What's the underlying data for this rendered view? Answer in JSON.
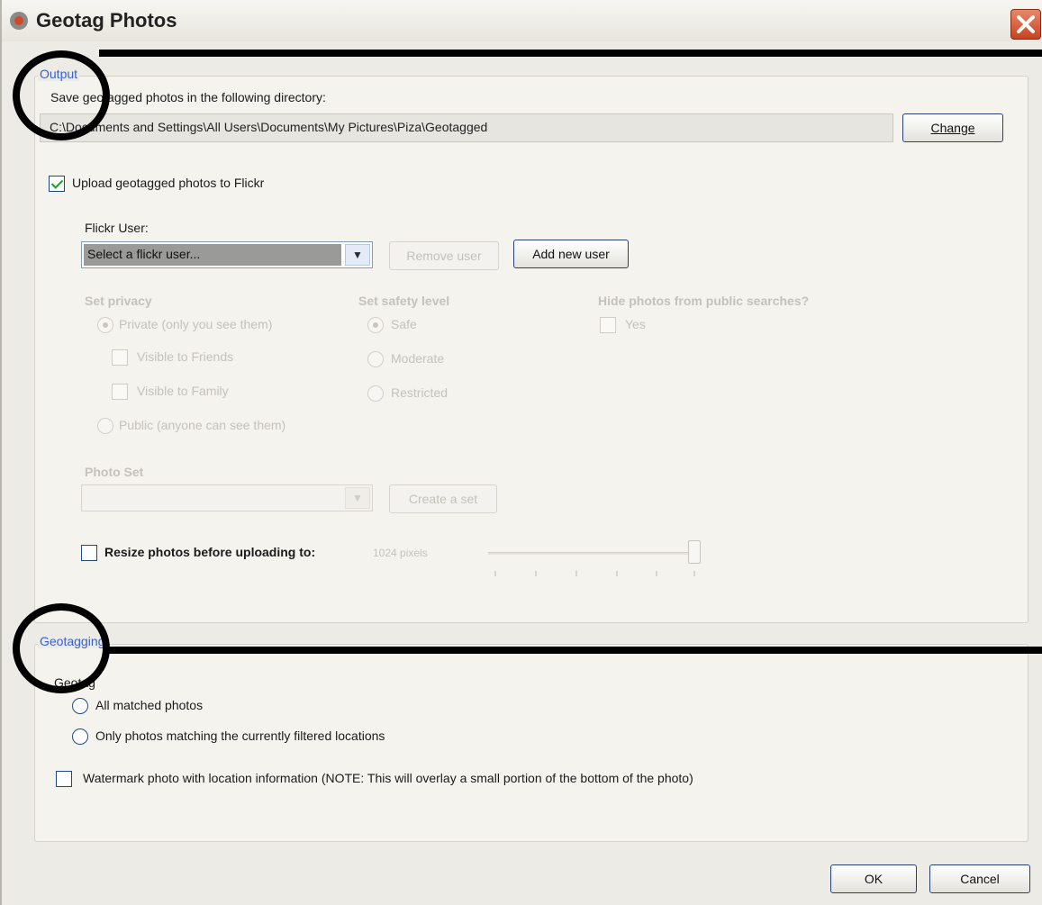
{
  "window": {
    "title": "Geotag Photos"
  },
  "output": {
    "legend": "Output",
    "save_label": "Save geotagged photos in the following directory:",
    "path_value": "C:\\Documents and Settings\\All Users\\Documents\\My Pictures\\Piza\\Geotagged",
    "change_button": "Change",
    "upload_label": "Upload geotagged photos to Flickr",
    "flickr_user_label": "Flickr User:",
    "flickr_user_select": "Select a flickr user...",
    "remove_user_button": "Remove user",
    "add_user_button": "Add new user",
    "privacy": {
      "heading": "Set privacy",
      "private": "Private (only you see them)",
      "friends": "Visible to Friends",
      "family": "Visible to Family",
      "public": "Public (anyone can see them)"
    },
    "safety": {
      "heading": "Set safety level",
      "safe": "Safe",
      "moderate": "Moderate",
      "restricted": "Restricted"
    },
    "hide": {
      "heading": "Hide photos from public searches?",
      "yes": "Yes"
    },
    "photo_set_heading": "Photo Set",
    "create_set_button": "Create a set",
    "resize_label": "Resize photos before uploading to:",
    "resize_value": "1024 pixels"
  },
  "geotagging": {
    "legend": "Geotagging",
    "geotag_label": "Geotag",
    "all_matched": "All matched photos",
    "only_filtered": "Only photos matching the currently filtered locations",
    "watermark": "Watermark photo with location information (NOTE: This will overlay a small portion of the bottom of the photo)"
  },
  "footer": {
    "ok_button": "OK",
    "cancel_button": "Cancel"
  },
  "colors": {
    "legend": "#3a5fcd",
    "close": "#c94222",
    "disabled_text": "#c4c2bb"
  }
}
